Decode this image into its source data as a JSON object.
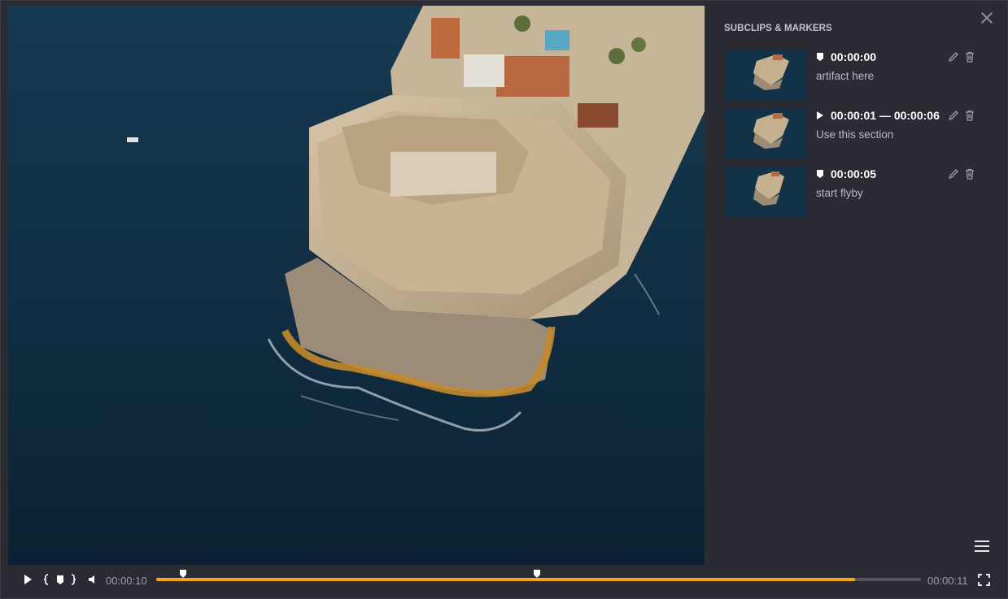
{
  "panel": {
    "title": "SUBCLIPS & MARKERS",
    "items": [
      {
        "type": "marker",
        "timecode": "00:00:00",
        "note": "artifact here",
        "icon": "marker-icon"
      },
      {
        "type": "subclip",
        "timecode": "00:00:01 — 00:00:06",
        "note": "Use this section",
        "icon": "play-icon"
      },
      {
        "type": "marker",
        "timecode": "00:00:05",
        "note": "start flyby",
        "icon": "marker-icon"
      }
    ]
  },
  "player": {
    "current_time": "00:00:10",
    "duration": "00:00:11",
    "progress_fraction": 0.914
  },
  "colors": {
    "accent": "#f2a81c",
    "background": "#2b2c33"
  }
}
